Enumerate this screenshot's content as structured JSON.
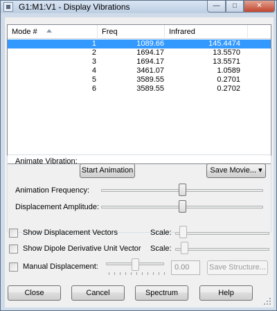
{
  "window": {
    "title": "G1:M1:V1 - Display Vibrations"
  },
  "title_controls": {
    "minimize": "—",
    "maximize": "□",
    "close": "✕"
  },
  "table": {
    "columns": [
      "Mode #",
      "Freq",
      "Infrared"
    ],
    "rows": [
      {
        "mode": "1",
        "freq": "1089.66",
        "ir": "145.4474",
        "selected": true
      },
      {
        "mode": "2",
        "freq": "1694.17",
        "ir": "13.5570"
      },
      {
        "mode": "3",
        "freq": "1694.17",
        "ir": "13.5571"
      },
      {
        "mode": "4",
        "freq": "3461.07",
        "ir": "1.0589"
      },
      {
        "mode": "5",
        "freq": "3589.55",
        "ir": "0.2701"
      },
      {
        "mode": "6",
        "freq": "3589.55",
        "ir": "0.2702"
      }
    ]
  },
  "animate": {
    "group_label": "Animate Vibration:",
    "start_button": "Start Animation",
    "save_movie_button": "Save Movie...",
    "frequency_label": "Animation Frequency:",
    "frequency_level": 0.5,
    "amplitude_label": "Displacement Amplitude:",
    "amplitude_level": 0.5
  },
  "options": {
    "show_vectors_label": "Show Displacement Vectors",
    "show_vectors_scale_label": "Scale:",
    "show_vectors_checked": false,
    "show_dipole_label": "Show Dipole Derivative Unit Vector",
    "show_dipole_scale_label": "Scale:",
    "show_dipole_checked": false,
    "manual_label": "Manual Displacement:",
    "manual_checked": false,
    "manual_value": "0.00",
    "save_structure_button": "Save Structure..."
  },
  "footer": {
    "close_button": "Close",
    "cancel_button": "Cancel",
    "spectrum_button": "Spectrum",
    "help_button": "Help"
  }
}
